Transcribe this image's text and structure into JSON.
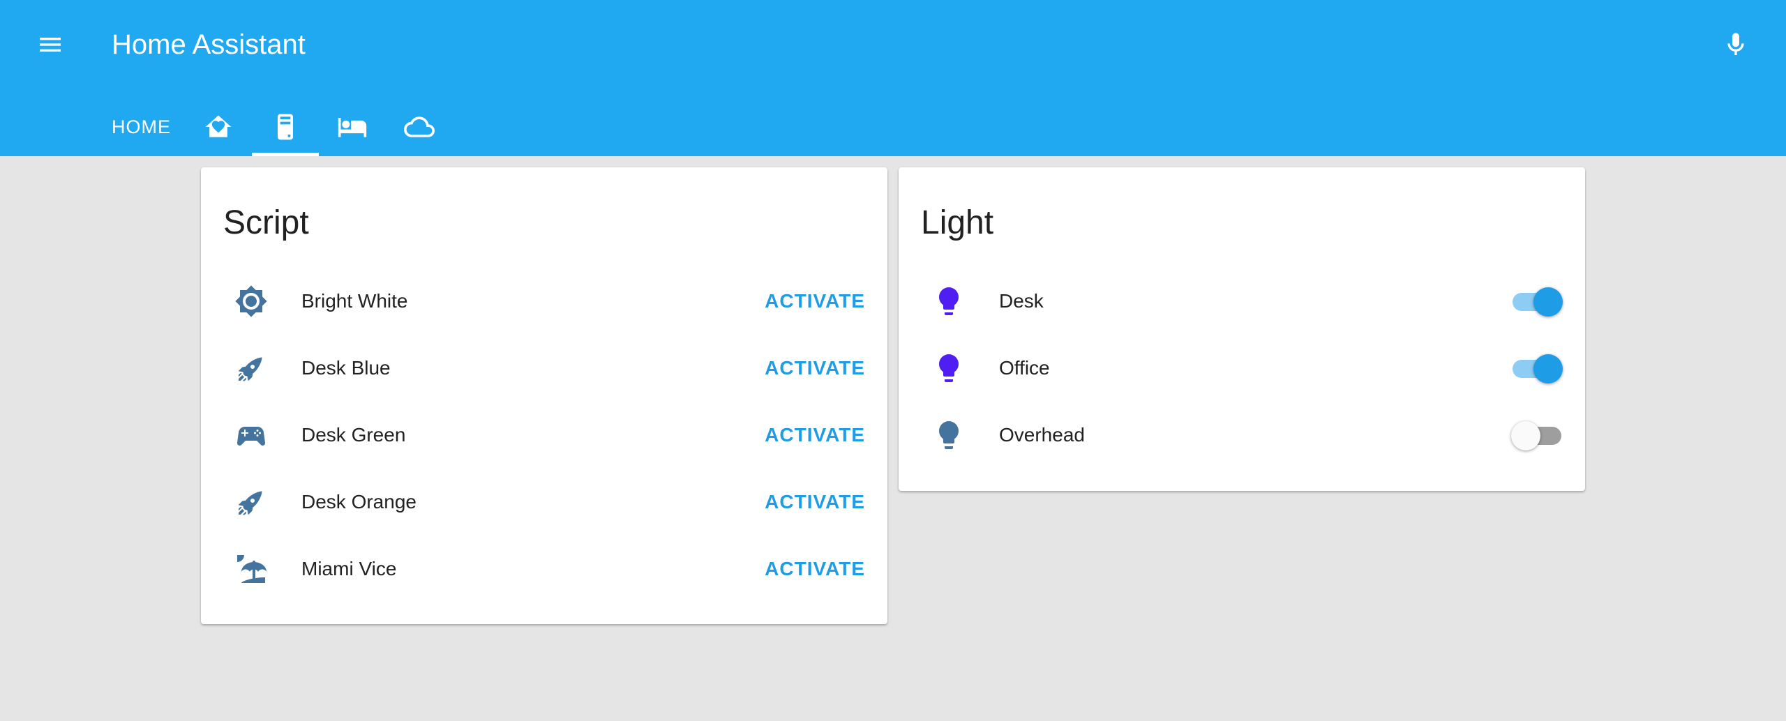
{
  "header": {
    "title": "Home Assistant",
    "menu_icon": "menu-icon",
    "mic_icon": "microphone-icon",
    "color": "#20a9f0"
  },
  "tabs": [
    {
      "label": "HOME",
      "type": "text",
      "selected": false
    },
    {
      "icon": "home-heart-icon",
      "type": "icon",
      "selected": false
    },
    {
      "icon": "server-icon",
      "type": "icon",
      "selected": true
    },
    {
      "icon": "bed-icon",
      "type": "icon",
      "selected": false
    },
    {
      "icon": "cloud-icon",
      "type": "icon",
      "selected": false
    }
  ],
  "script_card": {
    "title": "Script",
    "action_label": "ACTIVATE",
    "items": [
      {
        "name": "Bright White",
        "icon": "brightness-icon"
      },
      {
        "name": "Desk Blue",
        "icon": "rocket-icon"
      },
      {
        "name": "Desk Green",
        "icon": "gamepad-icon"
      },
      {
        "name": "Desk Orange",
        "icon": "rocket-icon"
      },
      {
        "name": "Miami Vice",
        "icon": "beach-icon"
      }
    ]
  },
  "light_card": {
    "title": "Light",
    "items": [
      {
        "name": "Desk",
        "icon": "lightbulb-icon",
        "on": true,
        "icon_color": "#4f1ff2"
      },
      {
        "name": "Office",
        "icon": "lightbulb-icon",
        "on": true,
        "icon_color": "#4f1ff2"
      },
      {
        "name": "Overhead",
        "icon": "lightbulb-icon",
        "on": false,
        "icon_color": "#44739e"
      }
    ]
  },
  "colors": {
    "accent": "#1f9ce6",
    "icon_default": "#44739e",
    "toggle_on_knob": "#1f9ce6",
    "toggle_on_track": "#8dcdf3",
    "toggle_off_knob": "#fafafa",
    "toggle_off_track": "#9e9e9e"
  }
}
